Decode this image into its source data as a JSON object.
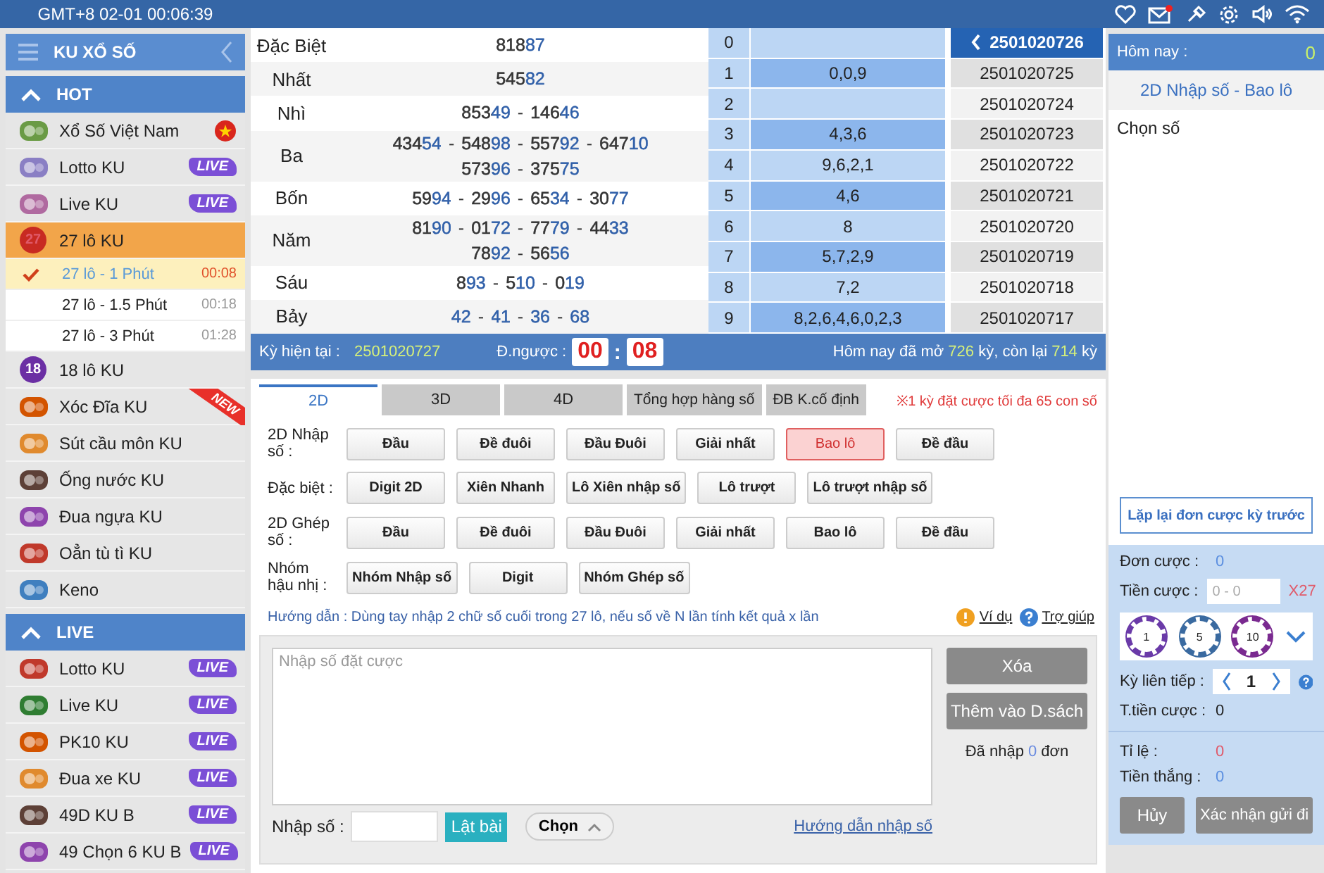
{
  "top_bar": {
    "clock": "GMT+8 02-01 00:06:39"
  },
  "sidebar": {
    "title": "KU XỔ SỐ",
    "sections": [
      {
        "title": "HOT",
        "expanded": true,
        "items": [
          {
            "label": "Xổ Số Việt Nam",
            "badge": {
              "kind": "flag"
            }
          },
          {
            "label": "Lotto KU",
            "badge": {
              "kind": "live",
              "text": "LIVE"
            }
          },
          {
            "label": "Live KU",
            "badge": {
              "kind": "live",
              "text": "LIVE"
            }
          },
          {
            "label": "27 lô KU",
            "ball": "27",
            "selected": true,
            "children": [
              {
                "label": "27 lô - 1 Phút",
                "time": "00:08",
                "selected": true
              },
              {
                "label": "27 lô - 1.5 Phút",
                "time": "00:18",
                "selected": false
              },
              {
                "label": "27 lô - 3 Phút",
                "time": "01:28",
                "selected": false
              }
            ]
          },
          {
            "label": "18 lô KU",
            "ball": "18",
            "selected": false
          },
          {
            "label": "Xóc Đĩa KU",
            "badge": {
              "kind": "new",
              "text": "NEW"
            }
          },
          {
            "label": "Sút cầu môn KU"
          },
          {
            "label": "Ống nước KU"
          },
          {
            "label": "Đua ngựa KU"
          },
          {
            "label": "Oẳn tù tì KU"
          },
          {
            "label": "Keno"
          }
        ]
      },
      {
        "title": "LIVE",
        "expanded": true,
        "items": [
          {
            "label": "Lotto KU",
            "badge": {
              "kind": "live",
              "text": "LIVE"
            }
          },
          {
            "label": "Live KU",
            "badge": {
              "kind": "live",
              "text": "LIVE"
            }
          },
          {
            "label": "PK10 KU",
            "badge": {
              "kind": "live",
              "text": "LIVE"
            }
          },
          {
            "label": "Đua xe KU",
            "badge": {
              "kind": "live",
              "text": "LIVE"
            }
          },
          {
            "label": "49D KU B",
            "badge": {
              "kind": "live",
              "text": "LIVE"
            }
          },
          {
            "label": "49 Chọn 6 KU B",
            "badge": {
              "kind": "live",
              "text": "LIVE"
            }
          }
        ]
      }
    ]
  },
  "results": {
    "separator": "-",
    "prizes": [
      {
        "name": "Đặc Biệt",
        "lines": [
          [
            "81887"
          ]
        ]
      },
      {
        "name": "Nhất",
        "lines": [
          [
            "54582"
          ]
        ]
      },
      {
        "name": "Nhì",
        "lines": [
          [
            "85349",
            "14646"
          ]
        ]
      },
      {
        "name": "Ba",
        "lines": [
          [
            "43454",
            "54898",
            "55792",
            "64710"
          ],
          [
            "57396",
            "37575"
          ]
        ]
      },
      {
        "name": "Bốn",
        "lines": [
          [
            "5994",
            "2996",
            "6534",
            "3077"
          ]
        ]
      },
      {
        "name": "Năm",
        "lines": [
          [
            "8190",
            "0172",
            "7779",
            "4433"
          ],
          [
            "7892",
            "5656"
          ]
        ]
      },
      {
        "name": "Sáu",
        "lines": [
          [
            "893",
            "510",
            "019"
          ]
        ]
      },
      {
        "name": "Bảy",
        "lines": [
          [
            "42",
            "41",
            "36",
            "68"
          ]
        ]
      }
    ],
    "tails": [
      {
        "head": "0"
      },
      {
        "head": "1",
        "tails": "0,0,9"
      },
      {
        "head": "2"
      },
      {
        "head": "3",
        "tails": "4,3,6"
      },
      {
        "head": "4",
        "tails": "9,6,2,1"
      },
      {
        "head": "5",
        "tails": "4,6"
      },
      {
        "head": "6",
        "tails": "8"
      },
      {
        "head": "7",
        "tails": "5,7,2,9"
      },
      {
        "head": "8",
        "tails": "7,2"
      },
      {
        "head": "9",
        "tails": "8,2,6,4,6,0,2,3"
      }
    ],
    "draws": [
      {
        "id": "2501020726",
        "selected": true
      },
      {
        "id": "2501020725",
        "selected": false
      },
      {
        "id": "2501020724",
        "selected": false
      },
      {
        "id": "2501020723",
        "selected": false
      },
      {
        "id": "2501020722",
        "selected": false
      },
      {
        "id": "2501020721",
        "selected": false
      },
      {
        "id": "2501020720",
        "selected": false
      },
      {
        "id": "2501020719",
        "selected": false
      },
      {
        "id": "2501020718",
        "selected": false
      },
      {
        "id": "2501020717",
        "selected": false
      }
    ]
  },
  "info_bar": {
    "current_label": "Kỳ hiện tại :",
    "current": "2501020727",
    "countdown_label": "Đ.ngược :",
    "minutes": "00",
    "colon": ":",
    "seconds": "08",
    "opened_label": "Hôm nay đã mở",
    "opened": "726",
    "remaining_label": "kỳ, còn lại",
    "remaining": "714",
    "unit": "kỳ"
  },
  "tabs": [
    {
      "label": "2D",
      "selected": true
    },
    {
      "label": "3D",
      "selected": false
    },
    {
      "label": "4D",
      "selected": false
    },
    {
      "label": "Tổng hợp hàng số",
      "selected": false
    },
    {
      "label": "ĐB K.cố định",
      "selected": false
    }
  ],
  "notice": "※1 kỳ đặt cược tối đa 65 con số",
  "bet_types": [
    {
      "label": "2D Nhập số :",
      "options": [
        {
          "label": "Đầu",
          "selected": false
        },
        {
          "label": "Đề đuôi",
          "selected": false
        },
        {
          "label": "Đầu Đuôi",
          "selected": false
        },
        {
          "label": "Giải nhất",
          "selected": false
        },
        {
          "label": "Bao lô",
          "selected": true
        },
        {
          "label": "Đề đầu",
          "selected": false
        }
      ]
    },
    {
      "label": "Đặc biệt :",
      "options": [
        {
          "label": "Digit 2D",
          "selected": false
        },
        {
          "label": "Xiên Nhanh",
          "selected": false
        },
        {
          "label": "Lô Xiên nhập số",
          "selected": false
        },
        {
          "label": "Lô trượt",
          "selected": false
        },
        {
          "label": "Lô trượt nhập số",
          "selected": false
        }
      ]
    },
    {
      "label": "2D Ghép số :",
      "options": [
        {
          "label": "Đầu",
          "selected": false
        },
        {
          "label": "Đề đuôi",
          "selected": false
        },
        {
          "label": "Đầu Đuôi",
          "selected": false
        },
        {
          "label": "Giải nhất",
          "selected": false
        },
        {
          "label": "Bao lô",
          "selected": false
        },
        {
          "label": "Đề đầu",
          "selected": false
        }
      ]
    },
    {
      "label": "Nhóm hậu nhị :",
      "options": [
        {
          "label": "Nhóm Nhập số",
          "selected": false
        },
        {
          "label": "Digit",
          "selected": false
        },
        {
          "label": "Nhóm Ghép số",
          "selected": false
        }
      ]
    }
  ],
  "guide": {
    "text": "Hướng dẫn : Dùng tay nhập 2 chữ số cuối trong 27 lô, nếu số về N lần tính kết quả x lần",
    "example_link": "Ví dụ",
    "help_link": "Trợ giúp"
  },
  "entry": {
    "placeholder": "Nhập số đặt cược",
    "clear_button": "Xóa",
    "add_button": "Thêm vào D.sách",
    "entered_label": "Đã nhập",
    "entered_count": "0",
    "entered_unit": "đơn",
    "number_label": "Nhập số :",
    "flip_button": "Lật bài",
    "choose_button": "Chọn",
    "input_help_link": "Hướng dẫn nhập số"
  },
  "bet_slip": {
    "today_label": "Hôm nay :",
    "today_count": "0",
    "title": "2D Nhập số - Bao lô",
    "choose_label": "Chọn số",
    "repeat_button": "Lặp lại đơn cược kỳ trước",
    "orders_label": "Đơn cược :",
    "orders": "0",
    "stake_label": "Tiền cược :",
    "stake_placeholder": "0 - 0",
    "multiplier": "X27",
    "chips": [
      "1",
      "5",
      "10"
    ],
    "streak_label": "Kỳ liên tiếp :",
    "streak": "1",
    "total_label": "T.tiền cược :",
    "total": "0",
    "odds_label": "Tỉ lệ :",
    "odds": "0",
    "win_label": "Tiền thắng :",
    "win": "0",
    "cancel_button": "Hủy",
    "confirm_button": "Xác nhận gửi đi"
  }
}
